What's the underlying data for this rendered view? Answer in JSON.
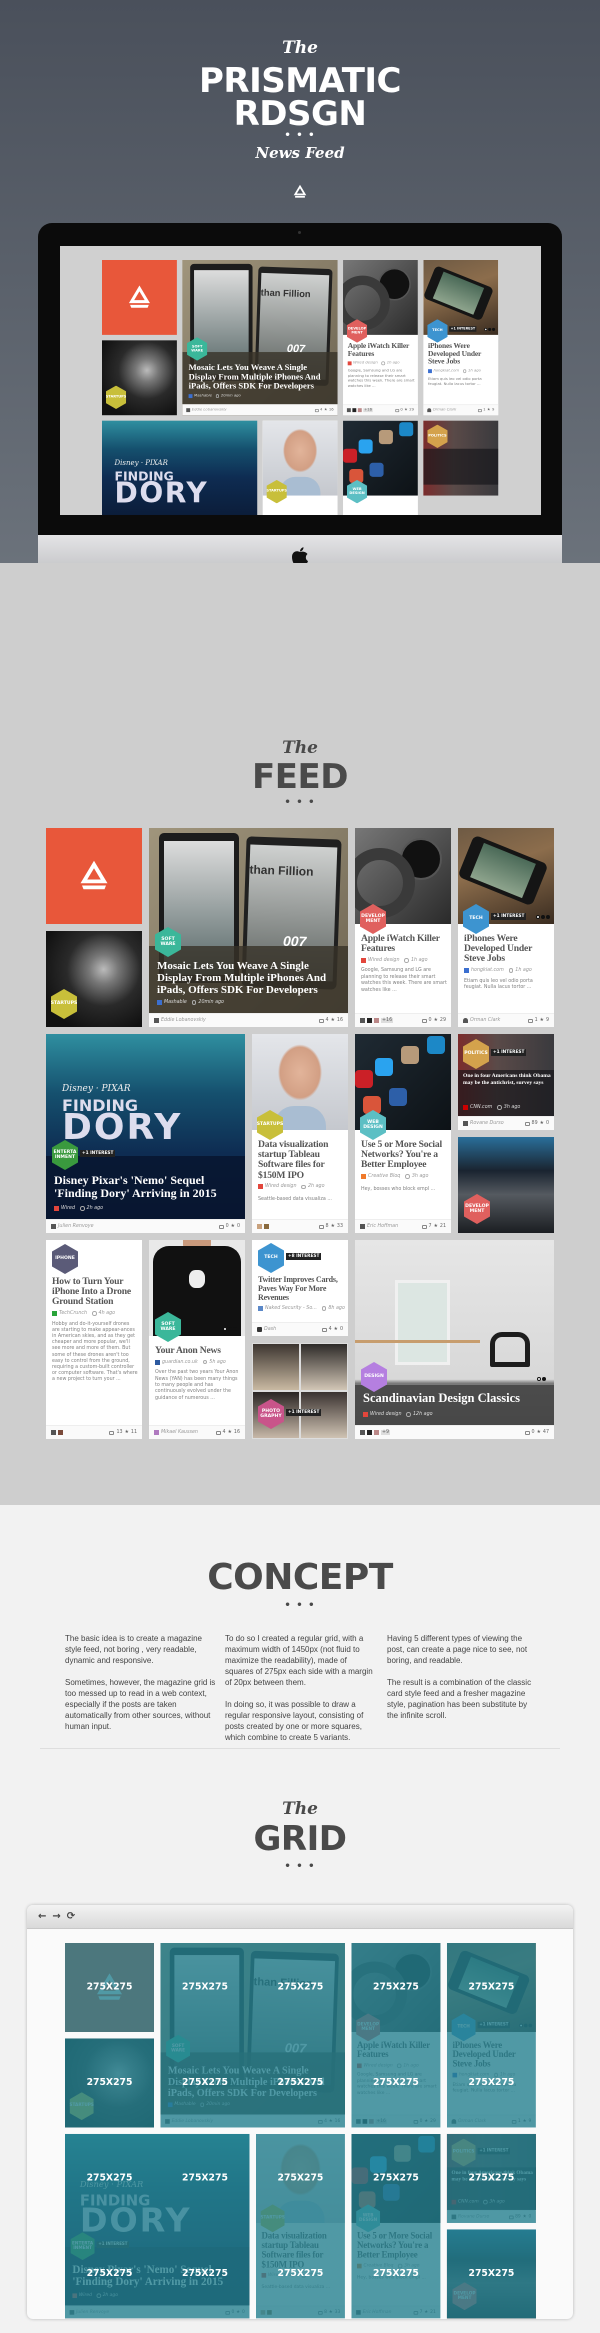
{
  "header": {
    "script": "The",
    "title_line1": "PRISMATIC",
    "title_line2": "RDSGN",
    "subtitle": "News Feed",
    "logo_icon": "prismatic-triangle-icon"
  },
  "feed_section": {
    "script": "The",
    "title": "FEED"
  },
  "colors": {
    "logo_orange": "#e8573a",
    "startups": "#c8bf3a",
    "software": "#3bb79a",
    "development": "#e0605e",
    "tech": "#3d94d0",
    "entertainment": "#3a9a3e",
    "web_design": "#5cbfc4",
    "politics": "#d4a24c",
    "iphone": "#5b5b78",
    "photography": "#c9548a",
    "design": "#b57fe0",
    "grid_overlay": "#24808e"
  },
  "feed": {
    "startups_tile": {
      "badge": "STARTUPS"
    },
    "mosaic": {
      "badge": "SOFT WARE",
      "image_text": "than Fillion",
      "image_text2": "007",
      "title": "Mosaic Lets You Weave A Single Display From Multiple iPhones And iPads, Offers SDK For Developers",
      "source": "Mashable",
      "time": "20min ago",
      "author": "Eddie Lobanovskiy",
      "comments": "4",
      "stars": "16"
    },
    "iwatch": {
      "badge": "DEVELOP MENT",
      "title": "Apple iWatch Killer Features",
      "source": "Wired design",
      "time": "1h ago",
      "excerpt": "Google, Samsung and LG are planning to release their smart watches this week. There are smart watches like ...",
      "more_avatars": "+16",
      "comments": "0",
      "stars": "29"
    },
    "iphones": {
      "badge": "TECH",
      "interest": "+1 INTEREST",
      "title": "iPhones Were Developed Under Steve Jobs",
      "source": "hongkiat.com",
      "time": "1h ago",
      "excerpt": "Etiam quis leo vel odio porta feugiat. Nulla lacus tortor ...",
      "author": "Orman Clark",
      "comments": "1",
      "stars": "9"
    },
    "dory": {
      "badge": "ENTERTA INMENT",
      "interest": "+1 INTEREST",
      "poster_brand": "Disney · PIXAR",
      "poster_line1": "FINDING",
      "poster_line2": "DORY",
      "title": "Disney Pixar's 'Nemo' Sequel 'Finding Dory' Arriving in 2015",
      "source": "Wired",
      "time": "2h ago",
      "author": "Julien Renvoye",
      "comments": "0",
      "stars": "0"
    },
    "dataviz": {
      "badge": "STARTUPS",
      "title": "Data visualization startup Tableau Software files for $150M IPO",
      "source": "Wired design",
      "time": "2h ago",
      "excerpt": "Seattle-based data visualiza ...",
      "comments": "8",
      "stars": "33"
    },
    "social": {
      "badge": "WEB DESIGN",
      "title": "Use 5 or More Social Networks? You're a Better Employee",
      "source": "Creative Bloq",
      "time": "3h ago",
      "excerpt": "Hey, bosses who block empl ...",
      "author": "Eric Hoffman",
      "comments": "7",
      "stars": "21"
    },
    "obama": {
      "badge": "POLITICS",
      "interest": "+1 INTEREST",
      "title": "One in four Americans think Obama may be the antichrist, survey says",
      "source": "CNN.com",
      "time": "3h ago",
      "author": "Rovane Durso",
      "comments": "89",
      "stars": "0"
    },
    "cybermen": {
      "badge": "DEVELOP MENT"
    },
    "drone": {
      "badge": "IPHONE",
      "title": "How to Turn Your iPhone Into a Drone Ground Station",
      "source": "TechCrunch",
      "time": "4h ago",
      "excerpt": "Hobby and do-it-yourself drones are starting to make appear-ances in American skies, and as they get cheaper and more popular, we'll see more and more of them. But some of these drones aren't too easy to control from the ground, requiring a custom-built controller or computer software. That's where a new project to turn your ...",
      "comments": "13",
      "stars": "11"
    },
    "anon": {
      "badge": "SOFT WARE",
      "title": "Your Anon News",
      "source": "guardian.co.uk",
      "time": "5h ago",
      "excerpt": "Over the past two years Your Anon News (YAN) has been many things to many people and has continuously evolved under the guidance of numerous ...",
      "author": "Mikael Kaussen",
      "comments": "4",
      "stars": "16"
    },
    "twitter": {
      "badge": "TECH",
      "interest": "+8 INTEREST",
      "title": "Twitter Improves Cards, Paves Way For More Revenues",
      "source": "Naked Security - So...",
      "time": "8h ago",
      "author": "Dash",
      "comments": "4",
      "stars": "0"
    },
    "yankees": {
      "badge": "PHOTO GRAPHY",
      "interest": "+1 INTEREST"
    },
    "scandi": {
      "badge": "DESIGN",
      "title": "Scandinavian Design Classics",
      "source": "Wired design",
      "time": "12h ago",
      "more_avatars": "+9",
      "comments": "0",
      "stars": "47"
    }
  },
  "concept": {
    "title": "CONCEPT",
    "columns": [
      [
        "The basic idea is to create a magazine style feed, not boring , very readable, dynamic and responsive.",
        "Sometimes, however, the magazine grid is too messed up to read in a web context, especially if the posts are taken automatically from other sources, without human input."
      ],
      [
        "To do so I created a regular grid, with a maximum width of 1450px (not fluid to maximize the readability), made of squares of 275px each side with a margin of 20px between them.",
        "In doing so, it was possible to draw a regular responsive layout, consisting of posts created by one or more squares, which combine to create 5 variants."
      ],
      [
        "Having 5 different types of viewing the post, can create a page nice to see, not boring, and readable.",
        "The result is a combination of the classic card style feed and a fresher magazine style, pagination has been substitute by the infinite scroll."
      ]
    ]
  },
  "grid_section": {
    "script": "The",
    "title": "GRID",
    "cell_label": "275X275",
    "browser_icons": [
      "back-arrow-icon",
      "forward-arrow-icon",
      "reload-icon"
    ]
  }
}
